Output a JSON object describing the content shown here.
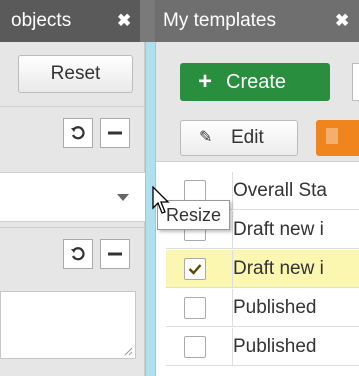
{
  "tabs": [
    {
      "label": "objects",
      "close": "✖"
    },
    {
      "label": "My templates",
      "close": "✖"
    }
  ],
  "left_panel": {
    "reset_label": "Reset"
  },
  "right_panel": {
    "create_label": "Create",
    "edit_label": "Edit"
  },
  "table": {
    "rows": [
      {
        "text": "Overall Sta",
        "checked": false,
        "selected": false
      },
      {
        "text": "Draft new i",
        "checked": false,
        "selected": false
      },
      {
        "text": "Draft new i",
        "checked": true,
        "selected": true
      },
      {
        "text": "Published",
        "checked": false,
        "selected": false
      },
      {
        "text": "Published",
        "checked": false,
        "selected": false
      }
    ]
  },
  "tooltip": {
    "text": "Resize"
  },
  "colors": {
    "create": "#2a8e3f",
    "delete": "#f0851e",
    "selected_row": "#fbf7b0",
    "splitter": "#aee0f0"
  }
}
